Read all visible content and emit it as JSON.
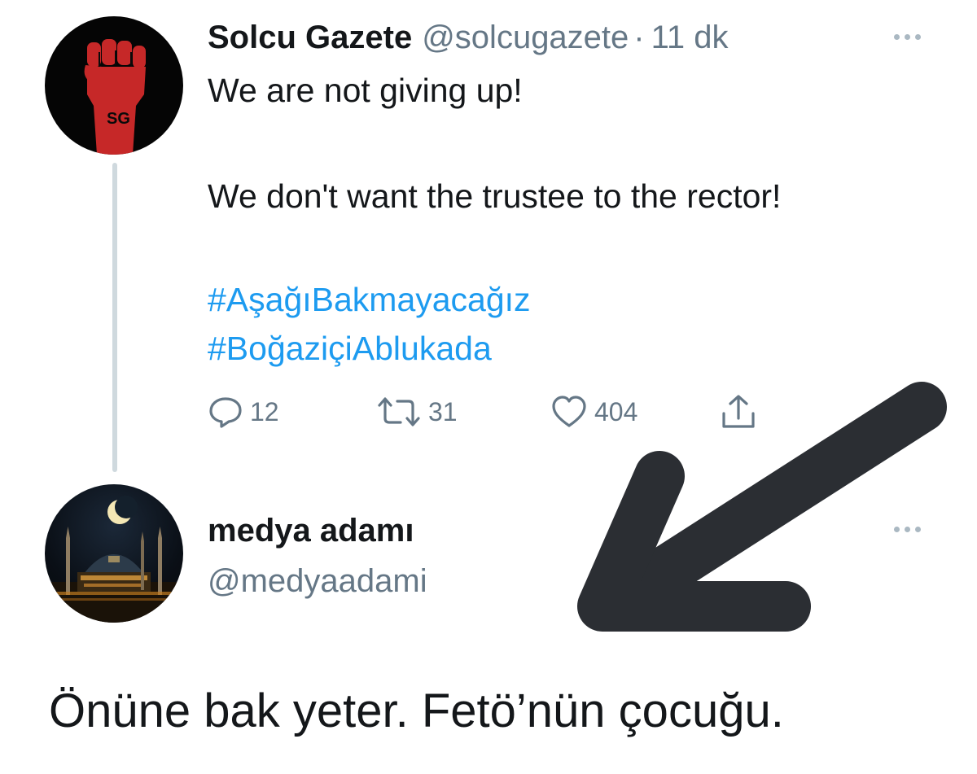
{
  "tweet": {
    "avatar_text": "SG",
    "author_name": "Solcu Gazete",
    "author_handle": "@solcugazete",
    "separator": "·",
    "time": "11 dk",
    "lines": [
      "We are not giving up!",
      "We don't want the trustee to the rector!"
    ],
    "hashtags": [
      "#AşağıBakmayacağız",
      "#BoğaziçiAblukada"
    ],
    "actions": {
      "reply_count": "12",
      "retweet_count": "31",
      "like_count": "404"
    }
  },
  "reply": {
    "author_name": "medya adamı",
    "author_handle": "@medyaadami",
    "text": "Önüne bak yeter. Fetö’nün çocuğu."
  },
  "colors": {
    "hashtag": "#1d9bf0",
    "muted": "#657786",
    "fist": "#c62828",
    "arrow": "#2b2e33"
  },
  "icons": [
    "reply-icon",
    "retweet-icon",
    "like-icon",
    "share-icon",
    "more-icon",
    "arrow-annotation"
  ]
}
